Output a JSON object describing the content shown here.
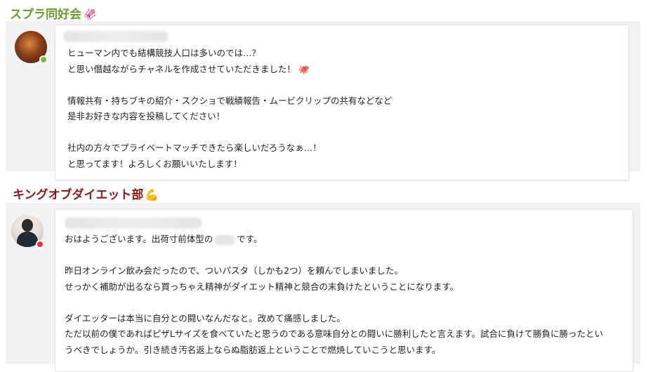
{
  "sections": [
    {
      "title": "スプラ同好会",
      "title_emoji": "🦑",
      "message": {
        "lines": [
          "ヒューマン内でも結構競技人口は多いのでは…？",
          "と思い僭越ながらチャネルを作成させていただきました！",
          "",
          "情報共有・持ちブキの紹介・スクショで戦績報告・ムービクリップの共有などなど",
          "是非お好きな内容を投稿してください！",
          "",
          "社内の方々でプライベートマッチできたら楽しいだろうなぁ…！",
          "と思ってます！よろしくお願いいたします！"
        ],
        "inline_emoji": "🐙"
      },
      "status": "online"
    },
    {
      "title": "キングオブダイエット部",
      "title_emoji": "💪",
      "message": {
        "line1_before": "おはようございます。出荷寸前体型の",
        "line1_after": "です。",
        "lines": [
          "",
          "昨日オンライン飲み会だったので、ついパスタ（しかも2つ）を頼んでしまいました。",
          "せっかく補助が出るなら買っちゃえ精神がダイエット精神と競合の末負けたということになります。",
          "",
          "ダイエッターは本当に自分との闘いなんだなと。改めて痛感しました。",
          "ただ以前の僕であればピザLサイズを食べていたと思うのである意味自分との闘いに勝利したと言えます。試合に負けて勝負に勝ったとい",
          "うべきでしょうか。引き続き汚名返上ならぬ脂肪返上ということで燃焼していこうと思います。"
        ]
      },
      "status": "busy"
    }
  ]
}
